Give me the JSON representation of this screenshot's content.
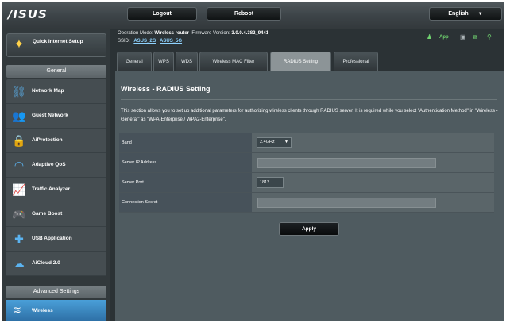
{
  "header": {
    "logo": "/ISUS",
    "logout_label": "Logout",
    "reboot_label": "Reboot",
    "language": "English"
  },
  "sidebar": {
    "quick_setup": "Quick Internet Setup",
    "general_heading": "General",
    "items": [
      {
        "label": "Network Map",
        "icon": "network-map-icon"
      },
      {
        "label": "Guest Network",
        "icon": "guest-network-icon"
      },
      {
        "label": "AiProtection",
        "icon": "lock-icon"
      },
      {
        "label": "Adaptive QoS",
        "icon": "gauge-icon"
      },
      {
        "label": "Traffic Analyzer",
        "icon": "chart-icon"
      },
      {
        "label": "Game Boost",
        "icon": "gamepad-icon"
      },
      {
        "label": "USB Application",
        "icon": "puzzle-icon"
      },
      {
        "label": "AiCloud 2.0",
        "icon": "cloud-icon"
      }
    ],
    "advanced_heading": "Advanced Settings",
    "active_item": "Wireless"
  },
  "info": {
    "operation_mode_label": "Operation Mode:",
    "operation_mode": "Wireless router",
    "firmware_label": "Firmware Version:",
    "firmware": "3.0.0.4.382_9441",
    "ssid_label": "SSID:",
    "ssid_24": "ASUS_2G",
    "ssid_5": "ASUS_5G",
    "app_label": "App"
  },
  "tabs": [
    {
      "label": "General",
      "active": false
    },
    {
      "label": "WPS",
      "active": false
    },
    {
      "label": "WDS",
      "active": false
    },
    {
      "label": "Wireless MAC Filter",
      "active": false
    },
    {
      "label": "RADIUS Setting",
      "active": true
    },
    {
      "label": "Professional",
      "active": false
    }
  ],
  "panel": {
    "title": "Wireless - RADIUS Setting",
    "description": "This section allows you to set up additional parameters for authorizing wireless clients through RADIUS server. It is required while you select \"Authentication Method\" in \"Wireless - General\" as \"WPA-Enterprise / WPA2-Enterprise\".",
    "fields": {
      "band_label": "Band",
      "band_value": "2.4GHz",
      "server_ip_label": "Server IP Address",
      "server_ip_value": "",
      "server_port_label": "Server Port",
      "server_port_value": "1812",
      "secret_label": "Connection Secret",
      "secret_value": ""
    },
    "apply_label": "Apply"
  },
  "colors": {
    "background": "#2b3235",
    "panel": "#4f5b60",
    "active_tab": "#8c9497",
    "accent_blue": "#4a9fd8"
  }
}
